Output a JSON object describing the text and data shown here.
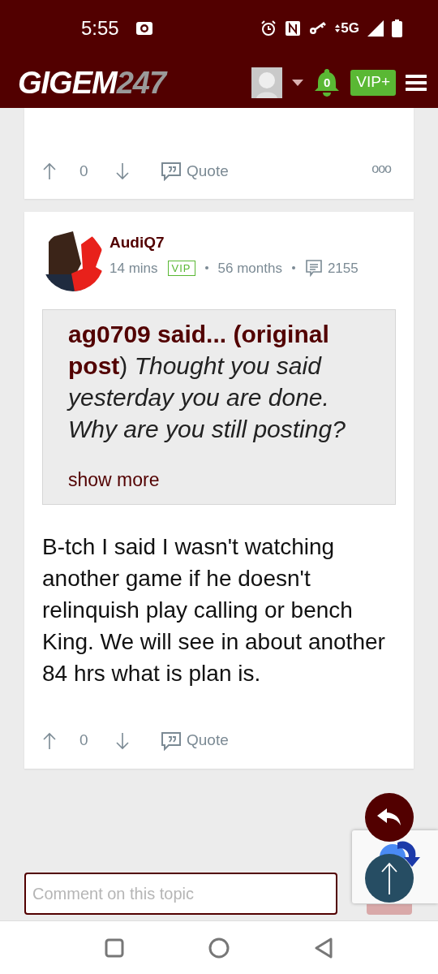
{
  "status_bar": {
    "time": "5:55",
    "network": "5G"
  },
  "header": {
    "logo_main": "GIGEM",
    "logo_accent": "247",
    "notifications": "0",
    "vip_button": "VIP+"
  },
  "posts": [
    {
      "kind": "tail",
      "votes": "0",
      "quote": "Quote",
      "more": "ooo"
    },
    {
      "kind": "full",
      "author": "AudiQ7",
      "time": "14 mins",
      "badge": "VIP",
      "tenure": "56 months",
      "post_count": "2155",
      "quote_block": {
        "text": "**ag0709 said... (original post**) *Thought you said yesterday you are done. Why are you still posting?*",
        "show_more": "show more"
      },
      "body": "B-tch I said I wasn't watching another game if he doesn't relinquish play calling or bench King. We will see in about another 84 hrs what is plan is.",
      "votes": "0",
      "quote": "Quote"
    }
  ],
  "comment": {
    "placeholder": "Comment on this topic"
  }
}
